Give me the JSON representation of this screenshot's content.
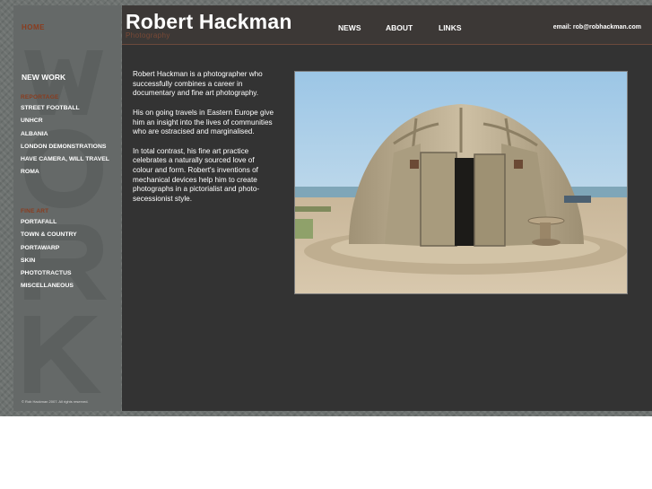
{
  "sidebar": {
    "home": "HOME",
    "new_work": "NEW WORK",
    "reportage": {
      "heading": "REPORTAGE",
      "items": [
        "STREET FOOTBALL",
        "UNHCR",
        "ALBANIA",
        "LONDON DEMONSTRATIONS",
        "HAVE CAMERA, WILL TRAVEL",
        "ROMA"
      ]
    },
    "fine_art": {
      "heading": "FINE ART",
      "items": [
        "PORTAFALL",
        "TOWN & COUNTRY",
        "PORTAWARP",
        "SKIN",
        "PHOTOTRACTUS",
        "MISCELLANEOUS"
      ]
    },
    "watermark": "WORK",
    "copyright": "© Rob Hackman 2007. All rights reserved."
  },
  "header": {
    "title": "Robert Hackman",
    "subtitle": "Photography",
    "nav": [
      "NEWS",
      "ABOUT",
      "LINKS"
    ],
    "email": "email: rob@robhackman.com"
  },
  "content": {
    "bio": [
      "Robert Hackman is a photographer who successfully combines a career in documentary and fine art photography.",
      "His on going travels in Eastern Europe give him an insight into the lives of communities who are ostracised and marginalised.",
      "In total contrast, his fine art practice celebrates a naturally sourced love of colour and form. Robert's inventions of mechanical devices help him to create photographs in a pictorialist and photo-secessionist style."
    ]
  },
  "colors": {
    "accent": "#8a3c1e",
    "header_bg": "#3c3836",
    "content_bg": "#333333",
    "sidebar_bg": "#656968"
  }
}
